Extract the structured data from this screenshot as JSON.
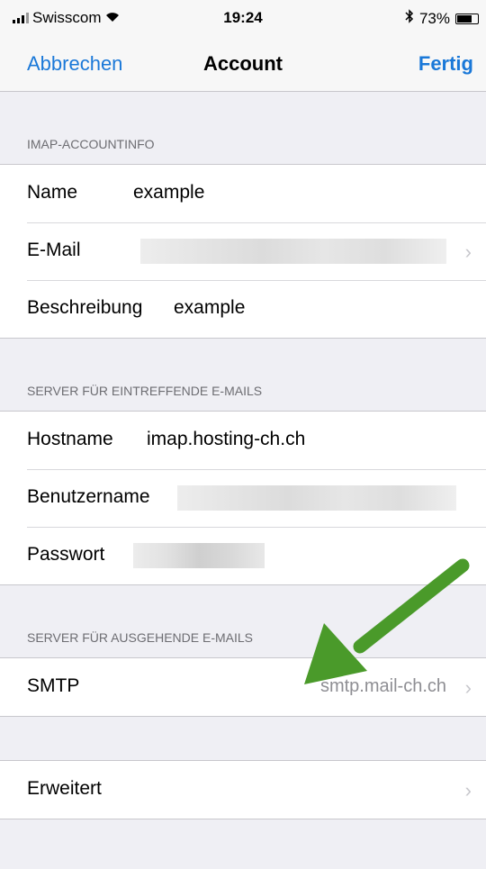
{
  "status_bar": {
    "carrier": "Swisscom",
    "time": "19:24",
    "battery_percent": "73%",
    "battery_level": 0.73
  },
  "nav": {
    "cancel": "Abbrechen",
    "title": "Account",
    "done": "Fertig"
  },
  "imap_section": {
    "header": "IMAP-ACCOUNTINFO",
    "rows": [
      {
        "label": "Name",
        "value": "example"
      },
      {
        "label": "E-Mail"
      },
      {
        "label": "Beschreibung",
        "value": "example"
      }
    ]
  },
  "incoming_section": {
    "header": "SERVER FÜR EINTREFFENDE E-MAILS",
    "rows": [
      {
        "label": "Hostname",
        "value": "imap.hosting-ch.ch"
      },
      {
        "label": "Benutzername"
      },
      {
        "label": "Passwort"
      }
    ]
  },
  "outgoing_section": {
    "header": "SERVER FÜR AUSGEHENDE E-MAILS",
    "rows": [
      {
        "label": "SMTP",
        "value": "smtp.mail-ch.ch"
      }
    ]
  },
  "advanced": {
    "label": "Erweitert"
  },
  "annotation": {
    "arrow_color": "#4a9a2a"
  },
  "colors": {
    "accent": "#1a78d8",
    "background": "#efeff4"
  }
}
